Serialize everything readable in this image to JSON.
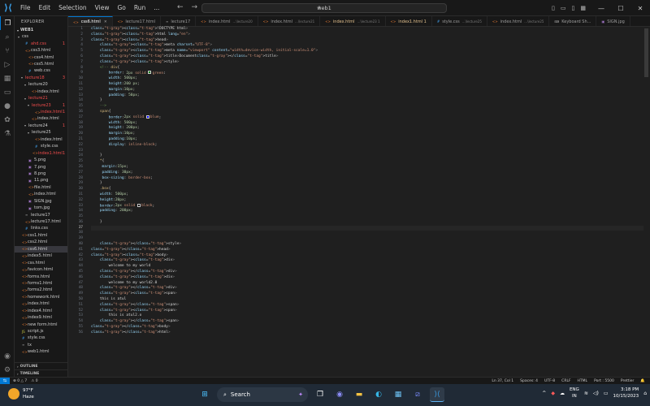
{
  "titlebar": {
    "menu": [
      "File",
      "Edit",
      "Selection",
      "View",
      "Go",
      "Run",
      "..."
    ],
    "search_text": "web1"
  },
  "sidebar": {
    "title": "EXPLORER",
    "root": "WEB1",
    "tree": [
      {
        "label": "css",
        "indent": 1,
        "folder": true,
        "open": true
      },
      {
        "label": "ahd.css",
        "indent": 2,
        "color": "#f14c4c",
        "badge": "1"
      },
      {
        "label": "css3.html",
        "indent": 2
      },
      {
        "label": "css4.html",
        "indent": 3
      },
      {
        "label": "css5.html",
        "indent": 3
      },
      {
        "label": "web.css",
        "indent": 3
      },
      {
        "label": "lecture18",
        "indent": 2,
        "folder": true,
        "color": "#f14c4c",
        "badge": "3"
      },
      {
        "label": "lecture20",
        "indent": 3,
        "folder": true
      },
      {
        "label": "index.html",
        "indent": 4
      },
      {
        "label": "lecture21",
        "indent": 3,
        "folder": true,
        "color": "#f14c4c"
      },
      {
        "label": "lecture23",
        "indent": 4,
        "folder": true,
        "color": "#f14c4c",
        "badge": "1"
      },
      {
        "label": "index.html",
        "indent": 5,
        "color": "#f14c4c",
        "badge": "1"
      },
      {
        "label": "index.html",
        "indent": 4
      },
      {
        "label": "lecture24",
        "indent": 3,
        "folder": true,
        "badge": "1"
      },
      {
        "label": "lecture25",
        "indent": 4,
        "folder": true
      },
      {
        "label": "index.html",
        "indent": 5
      },
      {
        "label": "style.css",
        "indent": 5
      },
      {
        "label": "index1.html",
        "indent": 5,
        "color": "#f14c4c",
        "badge": "1"
      },
      {
        "label": "5.png",
        "indent": 3
      },
      {
        "label": "7.png",
        "indent": 3
      },
      {
        "label": "8.png",
        "indent": 3
      },
      {
        "label": "11.png",
        "indent": 3
      },
      {
        "label": "file.html",
        "indent": 3
      },
      {
        "label": "index.html",
        "indent": 3
      },
      {
        "label": "SIGN.jpg",
        "indent": 3
      },
      {
        "label": "tom.jpg",
        "indent": 3
      },
      {
        "label": "lecture17",
        "indent": 2
      },
      {
        "label": "lecture17.html",
        "indent": 2
      },
      {
        "label": "links.css",
        "indent": 2
      },
      {
        "label": "css1.html",
        "indent": 1
      },
      {
        "label": "css2.html",
        "indent": 1
      },
      {
        "label": "css6.html",
        "indent": 1,
        "selected": true
      },
      {
        "label": "index5.html",
        "indent": 1
      },
      {
        "label": "css.html",
        "indent": 1
      },
      {
        "label": "favicon.html",
        "indent": 1
      },
      {
        "label": "forms.html",
        "indent": 1
      },
      {
        "label": "forms1.html",
        "indent": 1
      },
      {
        "label": "forms2.html",
        "indent": 1
      },
      {
        "label": "homework.html",
        "indent": 1
      },
      {
        "label": "index.html",
        "indent": 1
      },
      {
        "label": "index4.html",
        "indent": 1
      },
      {
        "label": "index9.html",
        "indent": 1
      },
      {
        "label": "new form.html",
        "indent": 1
      },
      {
        "label": "script.js",
        "indent": 1
      },
      {
        "label": "style.css",
        "indent": 1
      },
      {
        "label": "tx",
        "indent": 1
      },
      {
        "label": "web1.html",
        "indent": 1
      }
    ],
    "outline": "OUTLINE",
    "timeline": "TIMELINE"
  },
  "tabs": [
    {
      "name": "css6.html",
      "active": true
    },
    {
      "name": "lecture17.html"
    },
    {
      "name": "lecture17"
    },
    {
      "name": "index.html",
      "sub": "...\\lecture20"
    },
    {
      "name": "index.html",
      "sub": "...\\lecture21"
    },
    {
      "name": "index.html",
      "sub": "...\\lecture23 1",
      "modified": true
    },
    {
      "name": "index1.html 1",
      "modified": true
    },
    {
      "name": "style.css",
      "sub": "...\\lecture25"
    },
    {
      "name": "index.html",
      "sub": "...\\lecture25"
    },
    {
      "name": "Keyboard Sh..."
    },
    {
      "name": "SIGN.jpg"
    }
  ],
  "code_lines": [
    "<!DOCTYPE html>",
    "<html lang=\"en\">",
    "<head>",
    "    <meta charset=\"UTF-8\">",
    "    <meta name=\"viewport\" content=\"width=device-width, initial-scale=1.0\">",
    "    <title>Document</title>",
    "    <style>",
    "    <!-- div{",
    "        border: 2px solid #green;",
    "        width: 500px;",
    "        height:200 px;",
    "        margin:10px;",
    "        padding: 50px;",
    "    }",
    "    -->",
    "    span{",
    "        border:2px solid #blue;",
    "        width: 500px;",
    "        height: 200px;",
    "        margin:10px;",
    "        padding:10px;",
    "        display: inline-block;",
    "",
    "    }",
    "    *{",
    "     margin:15px;",
    "     padding: 30px;",
    "     box-sizing: border-box;",
    "    }",
    "    .box{",
    "    width: 500px;",
    "    height:20px;",
    "    border:2px solid #black;",
    "    padding: 200px;",
    "",
    "    }",
    "",
    "",
    "",
    "    </style>",
    "</head>",
    "<body>",
    "    <div>",
    "        welcome to my world",
    "    </div>",
    "    <div>",
    "        welcome to my world2.0",
    "    </div>",
    "    <span>",
    "    this is atul",
    "    </span>",
    "    <span>",
    "        this is atul2.o",
    "    </span>",
    "</body>",
    "</html>"
  ],
  "current_line": 37,
  "statusbar": {
    "left": [
      "⊗ 0 △ 7",
      "⚠ 0"
    ],
    "right": [
      "Ln 37, Col 1",
      "Spaces: 4",
      "UTF-8",
      "CRLF",
      "HTML",
      "Port : 5500",
      "Prettier"
    ]
  },
  "taskbar": {
    "temp": "97°F",
    "condition": "Haze",
    "search": "Search",
    "lang1": "ENG",
    "lang2": "IN",
    "time": "3:18 PM",
    "date": "10/15/2023"
  },
  "colors": {
    "accent": "#0078d4",
    "editor_bg": "#1f1f1f",
    "sidebar_bg": "#181818",
    "taskbar_bg": "#202a36"
  }
}
